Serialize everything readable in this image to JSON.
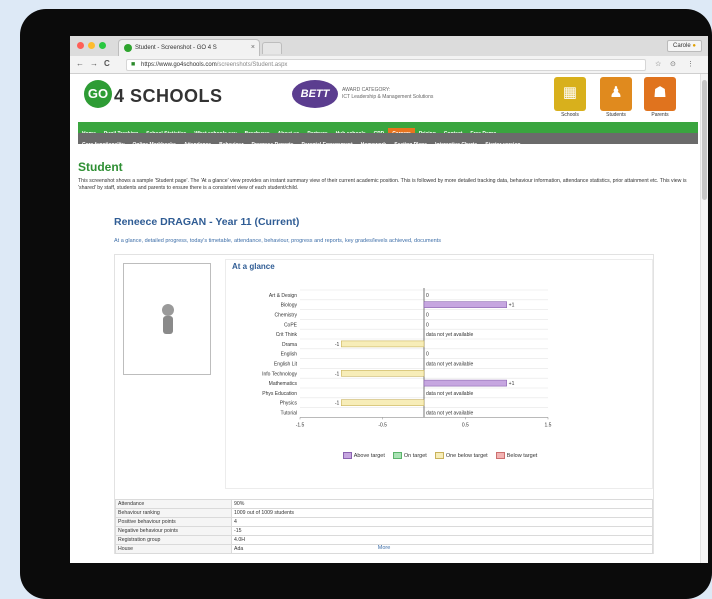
{
  "browser": {
    "tab_title": "Student - Screenshot - GO 4 S",
    "tab_close": "×",
    "user": "Carole",
    "url_host": "https://www.go4schools.com",
    "url_path": "/screenshots/Student.aspx",
    "back_glyph": "←",
    "forward_glyph": "→",
    "reload_glyph": "C",
    "home_glyph": "⌂",
    "lock_glyph": "🔒",
    "star_glyph": "☆",
    "ext_glyph": "⊙",
    "menu_glyph": "⋮",
    "traffic_colors": [
      "#ff5f57",
      "#febc2e",
      "#28c840"
    ]
  },
  "site": {
    "logo_bubble": "GO",
    "logo_text": "4 SCHOOLS",
    "award_badge": "BETT",
    "award_line1": "AWARD CATEGORY:",
    "award_line2": "ICT Leadership & Management Solutions",
    "quick_links": [
      {
        "label": "Schools",
        "icon": "school-icon",
        "glyph": "▦",
        "color": "#d8b01c"
      },
      {
        "label": "Students",
        "icon": "student-icon",
        "glyph": "♟",
        "color": "#e08a1e"
      },
      {
        "label": "Parents",
        "icon": "parents-icon",
        "glyph": "☗",
        "color": "#e0731e"
      }
    ],
    "nav_primary": [
      "Home",
      "Pupil Tracking",
      "School Statistics",
      "What schools say",
      "Brochures",
      "About us",
      "Partners",
      "Hub schools",
      "CPD",
      "Careers",
      "Pricing",
      "Contact",
      "Free Demo"
    ],
    "nav_primary_active": "Careers",
    "nav_secondary": [
      "Core functionality",
      "Online Markbooks",
      "Attendance",
      "Behaviour",
      "Progress Reports",
      "Parental Engagement",
      "Homework",
      "Seating Plans",
      "Interactive Charts",
      "Starter version"
    ]
  },
  "content": {
    "page_title": "Student",
    "intro": "This screenshot shows a sample 'Student page'. The 'At a glance' view provides an instant summary view of their current academic position. This is followed by more detailed tracking data, behaviour information, attendance statistics, prior attainment etc. This view is 'shared' by staff, students and parents to ensure there is a consistent view of each student/child.",
    "student_name": "Reneece DRAGAN - Year 11 (Current)",
    "subnav": "At a glance, detailed progress, today's timetable, attendance, behaviour, progress and reports, key grades/levels achieved, documents",
    "glance_title": "At a glance",
    "avatar_icon": "person-icon",
    "stats": [
      {
        "label": "Attendance",
        "value": "90%"
      },
      {
        "label": "Behaviour ranking",
        "value": "1009 out of 1009 students"
      },
      {
        "label": "Positive behaviour points",
        "value": "4"
      },
      {
        "label": "Negative behaviour points",
        "value": "-15"
      },
      {
        "label": "Registration group",
        "value": "4.0H"
      },
      {
        "label": "House",
        "value": "Ada"
      }
    ],
    "more_label": "More"
  },
  "chart_data": {
    "type": "bar",
    "orientation": "horizontal",
    "categories": [
      "Art & Design",
      "Biology",
      "Chemistry",
      "CoPE",
      "Crit Think",
      "Drama",
      "English",
      "English Lit",
      "Info Technology",
      "Mathematics",
      "Phys Education",
      "Physics",
      "Tutorial"
    ],
    "values": [
      0,
      1,
      0,
      0,
      null,
      -1,
      0,
      null,
      -1,
      1,
      null,
      -1,
      null
    ],
    "value_labels": [
      "0",
      "+1",
      "0",
      "0",
      "data not yet available",
      "-1",
      "0",
      "data not yet available",
      "-1",
      "+1",
      "data not yet available",
      "-1",
      "data not yet available"
    ],
    "xlim": [
      -1.5,
      1.5
    ],
    "xticks": [
      "-1.5",
      "-0.5",
      "0.5",
      "1.5"
    ],
    "grid": true,
    "legend": [
      {
        "name": "Above target",
        "color": "#c6a6e0",
        "border": "#8a63b0"
      },
      {
        "name": "On target",
        "color": "#a9e2b4",
        "border": "#5ab36a"
      },
      {
        "name": "One below target",
        "color": "#f7edb8",
        "border": "#c9b25b"
      },
      {
        "name": "Below target",
        "color": "#f2b3b3",
        "border": "#cc6f6f"
      }
    ],
    "legend_position": "bottom"
  }
}
